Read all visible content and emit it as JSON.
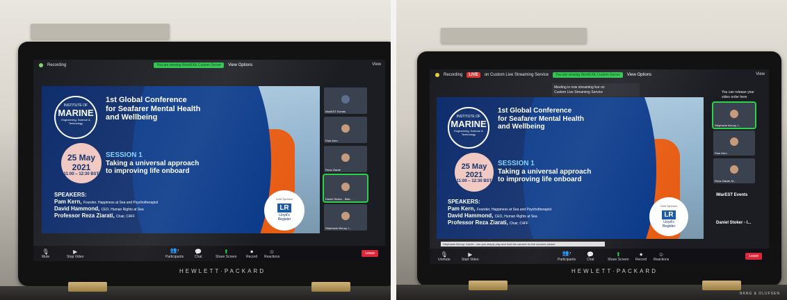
{
  "left": {
    "topbar": {
      "recording": "Recording",
      "banner": "You are viewing WorkEXE Custom Server",
      "view_options": "View Options",
      "view": "View"
    },
    "slide": {
      "logo": {
        "line1": "INSTITUTE OF",
        "line2": "MARINE",
        "line3": "Engineering, Science & Technology"
      },
      "title": [
        "1st Global Conference",
        "for Seafarer Mental Health",
        "and Wellbeing"
      ],
      "date": {
        "day": "25 May 2021",
        "time": "11:00 – 12:30 BST"
      },
      "session": {
        "label": "SESSION 1",
        "line1": "Taking a universal approach",
        "line2": "to improving life onboard"
      },
      "speakers_label": "SPEAKERS:",
      "speakers": [
        {
          "name": "Pam Kern,",
          "role": "Founder, Happiness at Sea and Psychotherapist"
        },
        {
          "name": "David Hammond,",
          "role": "CEO, Human Rights at Sea"
        },
        {
          "name": "Professor Reza Ziarati,",
          "role": "Chair, C4FF"
        }
      ],
      "sponsor": {
        "label": "Gold Sponsor",
        "mark": "LR",
        "name1": "Lloyd's",
        "name2": "Register"
      }
    },
    "participants": [
      "IMarEST Events",
      "Pam Kern",
      "Reza Ziarati",
      "Daniel Stoker - IMar...",
      "Stephanie McLay, I..."
    ],
    "toolbar": {
      "mute": "Mute",
      "stop_video": "Stop Video",
      "participants": "Participants",
      "participants_count": "7",
      "chat": "Chat",
      "share_screen": "Share Screen",
      "record": "Record",
      "reactions": "Reactions",
      "leave": "Leave"
    }
  },
  "right": {
    "topbar": {
      "recording": "Recording",
      "live": "LIVE",
      "streaming": "on Custom Live Streaming Service",
      "banner": "You are viewing WorkEXE Custom Server",
      "view_options": "View Options",
      "view": "View"
    },
    "notice": [
      "Meeting is now streaming live on",
      "Custom Live Streaming Service"
    ],
    "release": [
      "You can release your",
      "video order here"
    ],
    "participants": [
      "Stephanie McLay, I...",
      "Pam Kern",
      "Reza Ziarati, M..."
    ],
    "names": [
      "IMarEST Events",
      "Daniel Stoker - I..."
    ],
    "ticker": "Stephanie McLay: Daniel - can you simply play and hold the camera for the moment please",
    "toolbar": {
      "unmute": "Unmute",
      "start_video": "Start Video",
      "participants": "Participants",
      "participants_count": "7",
      "chat": "Chat",
      "share_screen": "Share Screen",
      "record": "Record",
      "reactions": "Reactions",
      "leave": "Leave"
    }
  },
  "hardware": {
    "brand": "HEWLETT·PACKARD",
    "base_brand": "BANG & OLUFSEN"
  },
  "colors": {
    "slide_navy": "#0d2c6b",
    "coat_orange": "#e85d14",
    "zoom_green": "#2bd24a",
    "leave_red": "#d8283a",
    "live_red": "#e0322f"
  },
  "icons": [
    "microphone-icon",
    "video-camera-icon",
    "participants-icon",
    "chat-icon",
    "share-screen-icon",
    "record-icon",
    "reactions-icon"
  ]
}
